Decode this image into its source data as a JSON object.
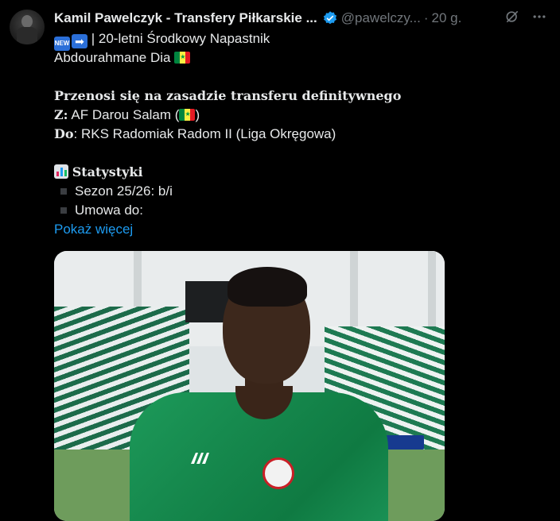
{
  "header": {
    "author_name": "Kamil Pawelczyk - Transfery Piłkarskie ...",
    "handle": "@pawelczy...",
    "separator": "·",
    "timestamp": "20 g."
  },
  "tweet": {
    "line1": "| 20-letni Środkowy Napastnik",
    "line2": "Abdourahmane Dia",
    "heading_transfer": "Przenosi się na zasadzie transferu definitywnego",
    "from_label": "Z:",
    "from_text": "AF Darou Salam (",
    "from_text_end": ")",
    "to_label": "Do",
    "to_text": ": RKS Radomiak Radom II (Liga Okręgowa)",
    "stats_heading": "Statystyki",
    "stat1": "Sezon 25/26: b/i",
    "stat2": "Umowa do:",
    "show_more": "Pokaż więcej"
  },
  "icons": {
    "new_badge": "NEW",
    "arrow": "➡",
    "flag": "senegal-flag",
    "verified": "verified-badge-icon",
    "grok": "grok-icon",
    "more": "more-icon"
  },
  "colors": {
    "accent": "#1d9bf0",
    "muted": "#71767b",
    "text": "#e7e9ea"
  }
}
